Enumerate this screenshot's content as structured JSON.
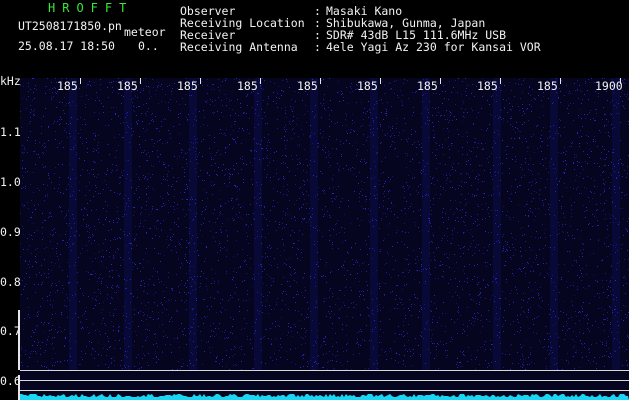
{
  "header": {
    "app_name": "HROFFT",
    "filename": "UT2508171850.pn",
    "meteor_label": "meteor",
    "datetime": "25.08.17 18:50",
    "count_value": "0..",
    "info": [
      {
        "label": "Observer",
        "sep": ":",
        "value": "Masaki Kano"
      },
      {
        "label": "Receiving Location",
        "sep": ":",
        "value": "Shibukawa, Gunma, Japan"
      },
      {
        "label": "Receiver",
        "sep": ":",
        "value": "SDR# 43dB L15 111.6MHz USB"
      },
      {
        "label": "Receiving Antenna",
        "sep": ":",
        "value": "4ele Yagi Az 230 for Kansai VOR"
      }
    ]
  },
  "chart_data": {
    "type": "heatmap",
    "ylabel": "kHz",
    "x_tick_labels": [
      "185",
      "185",
      "185",
      "185",
      "185",
      "185",
      "185",
      "185",
      "185",
      "1900"
    ],
    "y_tick_labels": [
      "1.1",
      "1.0",
      "0.9",
      "0.8",
      "0.7",
      "0.6"
    ],
    "colors": {
      "background": "#05051f",
      "noise": "#2a2ad0",
      "bottom_trace": "#19d6f5"
    }
  }
}
